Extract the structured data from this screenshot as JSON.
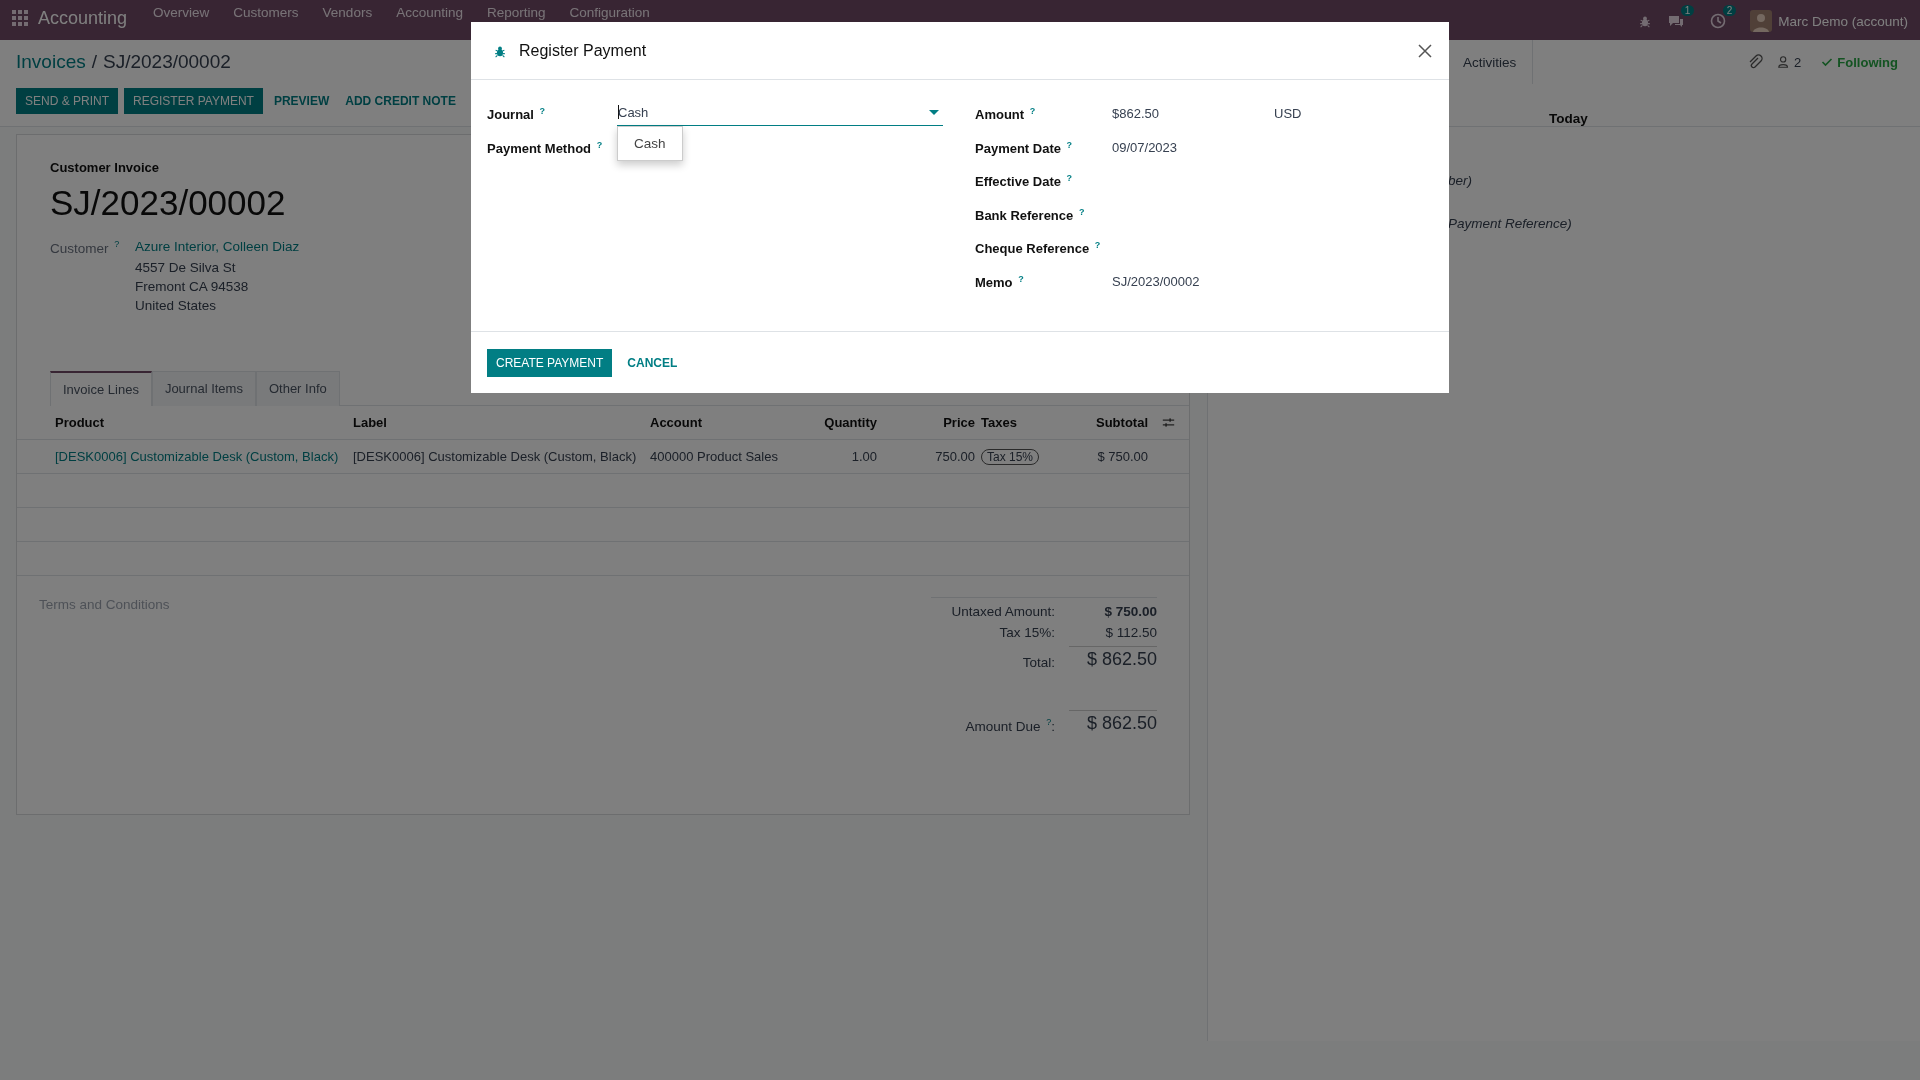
{
  "navbar": {
    "app_name": "Accounting",
    "menu": [
      "Overview",
      "Customers",
      "Vendors",
      "Accounting",
      "Reporting",
      "Configuration"
    ],
    "messages_badge": "1",
    "activities_badge": "2",
    "user": "Marc Demo (account)"
  },
  "breadcrumb": {
    "parent": "Invoices",
    "separator": "/",
    "current": "SJ/2023/00002"
  },
  "actions": [
    {
      "label": "SEND & PRINT",
      "kind": "primary"
    },
    {
      "label": "REGISTER PAYMENT",
      "kind": "primary"
    },
    {
      "label": "PREVIEW",
      "kind": "link"
    },
    {
      "label": "ADD CREDIT NOTE",
      "kind": "link"
    }
  ],
  "chatter": {
    "activities": "Activities",
    "followers": "2",
    "following": "Following",
    "date_separator": "Today",
    "fragments": [
      "ber)",
      "Payment Reference)"
    ]
  },
  "invoice": {
    "type": "Customer Invoice",
    "number": "SJ/2023/00002",
    "customer_label": "Customer $^{?}$",
    "customer": "Azure Interior, Colleen Diaz",
    "address": [
      "4557 De Silva St",
      "Fremont CA 94538",
      "United States"
    ]
  },
  "tabs": [
    {
      "label": "Invoice Lines",
      "selected": true
    },
    {
      "label": "Journal Items",
      "selected": false
    },
    {
      "label": "Other Info",
      "selected": false
    }
  ],
  "table": {
    "columns": [
      "Product",
      "Label",
      "Account",
      "Quantity",
      "Price",
      "Taxes",
      "Subtotal"
    ],
    "rows": [
      {
        "product": "[DESK0006] Customizable Desk (Custom, Black)",
        "label": "[DESK0006] Customizable Desk (Custom, Black)",
        "account": "400000 Product Sales",
        "quantity": "1.00",
        "price": "750.00",
        "taxes": [
          "Tax 15%"
        ],
        "subtotal": "$ 750.00"
      }
    ]
  },
  "terms_placeholder": "Terms and Conditions",
  "totals": [
    {
      "label": "Untaxed Amount:",
      "value": "$ 750.00",
      "kind": "bold"
    },
    {
      "label": "Tax 15%:",
      "value": "$ 112.50",
      "kind": "normal"
    },
    {
      "label": "Total:",
      "value": "$ 862.50",
      "kind": "total"
    }
  ],
  "amount_due": {
    "label": "Amount Due $^{?}$:",
    "value": "$ 862.50"
  },
  "dialog": {
    "title": "Register Payment",
    "left_fields": [
      {
        "label": "Journal $^{?}$",
        "value": "Cash",
        "kind": "dropdown",
        "options": [
          "Cash"
        ]
      },
      {
        "label": "Payment Method $^{?}$",
        "kind": "empty"
      }
    ],
    "right_fields": [
      {
        "label": "Amount $^{?}$",
        "value": "$862.50",
        "currency": "USD",
        "kind": "monetary"
      },
      {
        "label": "Payment Date $^{?}$",
        "value": "09/07/2023",
        "kind": "text"
      },
      {
        "label": "Effective Date $^{?}$",
        "kind": "empty"
      },
      {
        "label": "Bank Reference $^{?}$",
        "kind": "empty"
      },
      {
        "label": "Cheque Reference $^{?}$",
        "kind": "empty"
      },
      {
        "label": "Memo $^{?}$",
        "value": "SJ/2023/00002",
        "kind": "text"
      }
    ],
    "buttons": [
      {
        "label": "CREATE PAYMENT",
        "kind": "primary"
      },
      {
        "label": "CANCEL",
        "kind": "link"
      }
    ]
  }
}
